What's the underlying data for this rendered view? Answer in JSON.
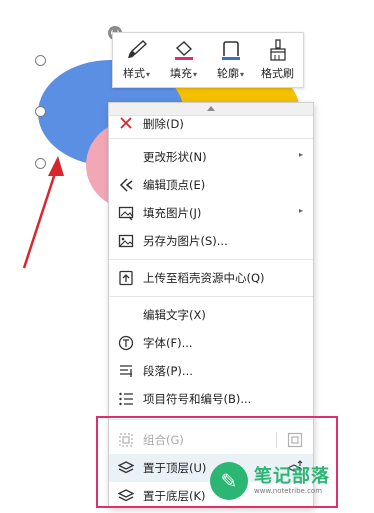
{
  "toolbar": {
    "items": [
      {
        "label": "样式",
        "has_caret": true,
        "icon": "brush-icon"
      },
      {
        "label": "填充",
        "has_caret": true,
        "icon": "paint-bucket-icon"
      },
      {
        "label": "轮廓",
        "has_caret": true,
        "icon": "outline-icon"
      },
      {
        "label": "格式刷",
        "has_caret": false,
        "icon": "format-painter-icon"
      }
    ]
  },
  "context_menu": {
    "items": {
      "delete": "删除(D)",
      "change_shape": "更改形状(N)",
      "edit_points": "编辑顶点(E)",
      "fill_picture": "填充图片(J)",
      "save_as_picture": "另存为图片(S)...",
      "upload": "上传至稻壳资源中心(Q)",
      "edit_text": "编辑文字(X)",
      "font": "字体(F)...",
      "paragraph": "段落(P)...",
      "bullets": "项目符号和编号(B)...",
      "group": "组合(G)",
      "bring_to_front": "置于顶层(U)",
      "send_to_back": "置于底层(K)"
    }
  },
  "colors": {
    "ellipse_blue": "#5b8fe4",
    "ellipse_yellow": "#f5c000",
    "ellipse_pink": "#f2a7b6",
    "highlight_border": "#e0306a",
    "arrow": "#d9262e",
    "watermark": "#2bb673"
  },
  "watermark": {
    "title": "笔记部落",
    "url": "www.notetribe.com"
  }
}
